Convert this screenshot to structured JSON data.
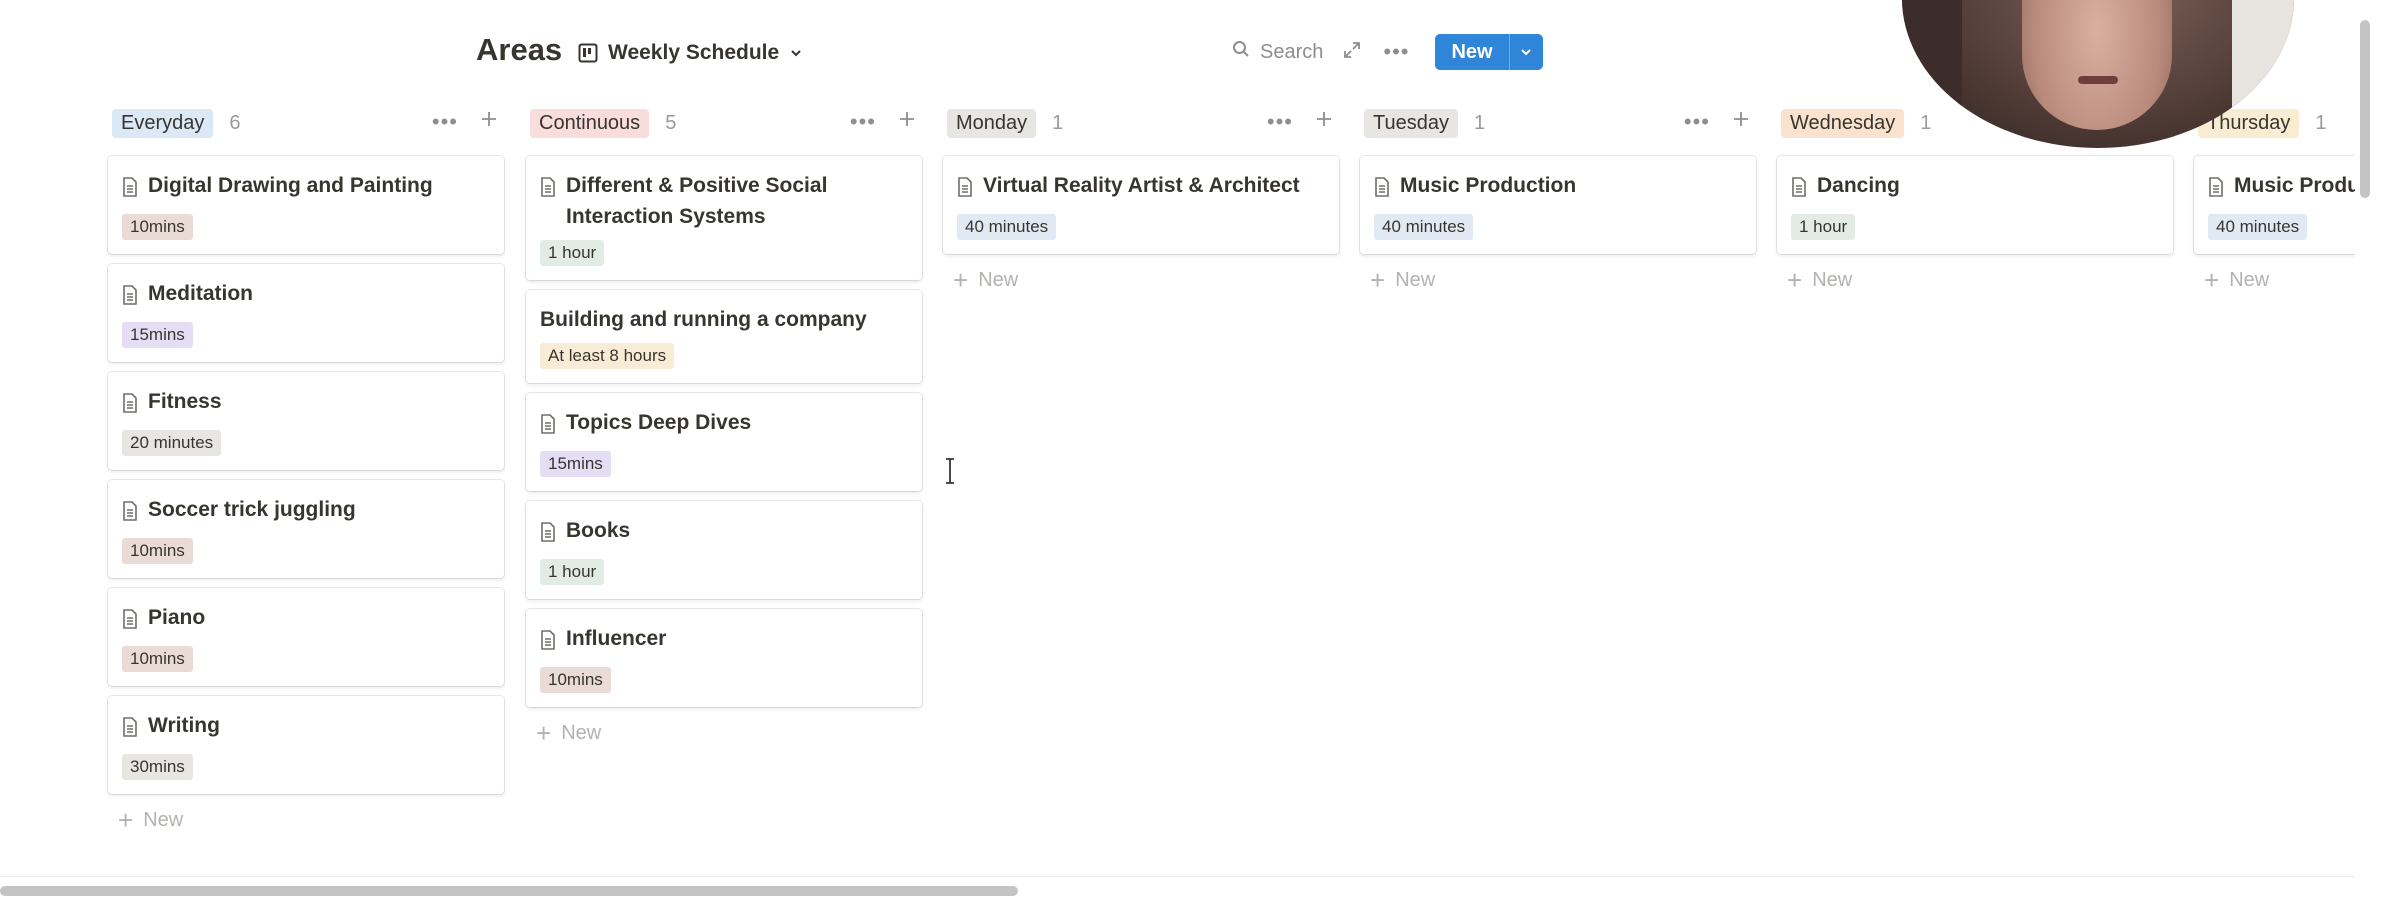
{
  "header": {
    "title": "Areas",
    "view_label": "Weekly Schedule",
    "search_label": "Search",
    "new_label": "New"
  },
  "columns": [
    {
      "label": "Everyday",
      "count": "6",
      "pill_color": "#dbe8f6",
      "cards": [
        {
          "title": "Digital Drawing and Painting",
          "tag": "10mins",
          "tag_color": "#eadbd6"
        },
        {
          "title": "Meditation",
          "tag": "15mins",
          "tag_color": "#e4ddf4"
        },
        {
          "title": "Fitness",
          "tag": "20 minutes",
          "tag_color": "#e7e6e3"
        },
        {
          "title": "Soccer trick juggling",
          "tag": "10mins",
          "tag_color": "#eadbd6"
        },
        {
          "title": "Piano",
          "tag": "10mins",
          "tag_color": "#eadbd6"
        },
        {
          "title": "Writing",
          "tag": "30mins",
          "tag_color": "#e7e6e3"
        }
      ],
      "new_label": "New"
    },
    {
      "label": "Continuous",
      "count": "5",
      "pill_color": "#f9dcdc",
      "cards": [
        {
          "title": "Different & Positive Social Interaction Systems",
          "tag": "1 hour",
          "tag_color": "#e2ece4"
        },
        {
          "title": "Building and running a company",
          "tag": "At least 8 hours",
          "tag_color": "#f9ecd7"
        },
        {
          "title": "Topics Deep Dives",
          "tag": "15mins",
          "tag_color": "#e4ddf4"
        },
        {
          "title": "Books",
          "tag": "1 hour",
          "tag_color": "#e2ece4"
        },
        {
          "title": "Influencer",
          "tag": "10mins",
          "tag_color": "#eadbd6"
        }
      ],
      "new_label": "New"
    },
    {
      "label": "Monday",
      "count": "1",
      "pill_color": "#e7e6e3",
      "cards": [
        {
          "title": "Virtual Reality Artist & Architect",
          "tag": "40 minutes",
          "tag_color": "#e1e9f3"
        }
      ],
      "new_label": "New"
    },
    {
      "label": "Tuesday",
      "count": "1",
      "pill_color": "#e7e6e3",
      "cards": [
        {
          "title": "Music Production",
          "tag": "40 minutes",
          "tag_color": "#e1e9f3"
        }
      ],
      "new_label": "New"
    },
    {
      "label": "Wednesday",
      "count": "1",
      "pill_color": "#fbe2cf",
      "cards": [
        {
          "title": "Dancing",
          "tag": "1 hour",
          "tag_color": "#e2ece4"
        }
      ],
      "new_label": "New"
    },
    {
      "label": "Thursday",
      "count": "1",
      "pill_color": "#f8edd2",
      "cards": [
        {
          "title": "Music Produ",
          "tag": "40 minutes",
          "tag_color": "#e1e9f3"
        }
      ],
      "new_label": "New"
    }
  ],
  "icons": {
    "card": "page-icon",
    "view": "board-view-icon",
    "search": "search-icon",
    "expand": "expand-icon",
    "more": "more-icon",
    "add": "plus-icon"
  },
  "accent_color": "#2f85d8"
}
